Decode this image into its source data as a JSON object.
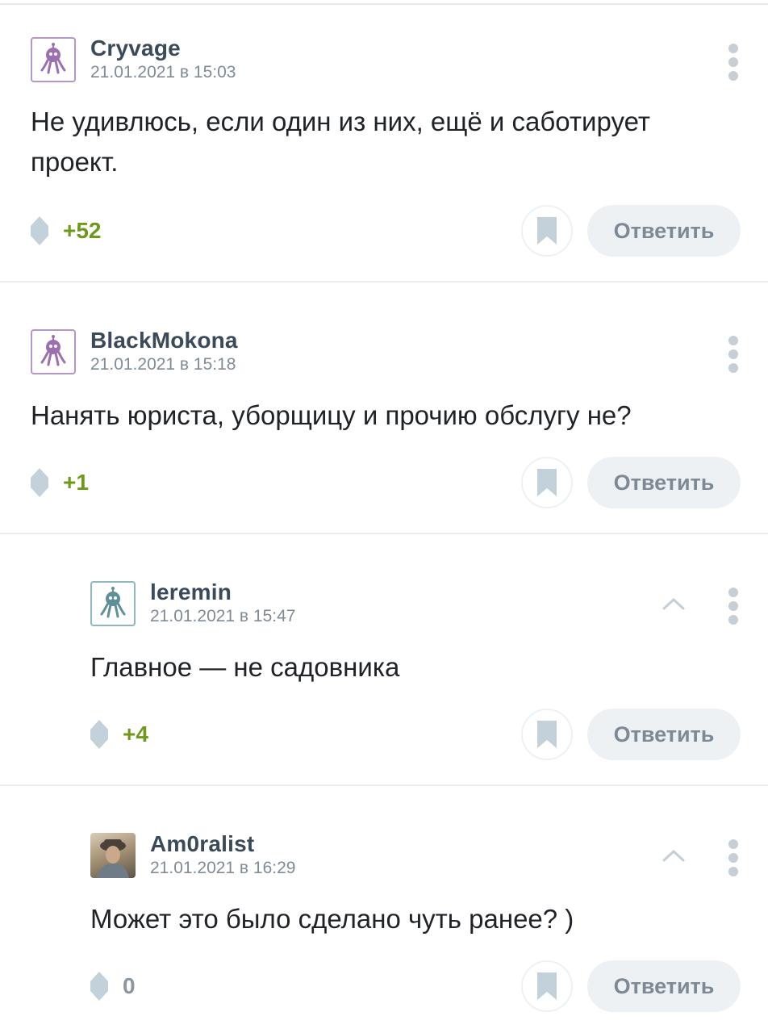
{
  "colors": {
    "rating_positive": "#6e9a1b",
    "rating_zero": "#8a96a2",
    "author": "#3b4a5a",
    "reply_button_bg": "#eef1f4"
  },
  "icons": {
    "more": "vertical-dots-icon",
    "bookmark": "bookmark-icon",
    "vote": "diamond-vote-icon",
    "collapse": "chevron-up-icon",
    "default_avatar": "octopus-avatar-icon"
  },
  "comments": [
    {
      "author": "Cryvage",
      "date": "21.01.2021 в 15:03",
      "text_lines": [
        "Не удивлюсь, если один из них, ещё и саботирует",
        "проект."
      ],
      "rating": "+52",
      "reply_label": "Ответить"
    },
    {
      "author": "BlackMokona",
      "date": "21.01.2021 в 15:18",
      "text_lines": [
        "Нанять юриста, уборщицу и прочию обслугу не?"
      ],
      "rating": "+1",
      "reply_label": "Ответить"
    },
    {
      "author": "leremin",
      "date": "21.01.2021 в 15:47",
      "text_lines": [
        "Главное — не садовника"
      ],
      "rating": "+4",
      "reply_label": "Ответить"
    },
    {
      "author": "Am0ralist",
      "date": "21.01.2021 в 16:29",
      "text_lines": [
        "Может это было сделано чуть ранее? )"
      ],
      "rating": "0",
      "reply_label": "Ответить"
    }
  ]
}
